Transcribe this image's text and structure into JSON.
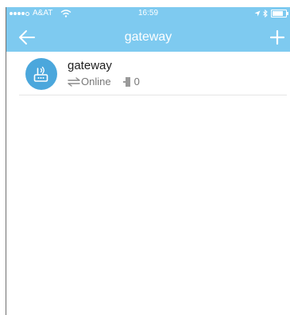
{
  "status_bar": {
    "carrier": "A&AT",
    "time": "16:59"
  },
  "header": {
    "title": "gateway",
    "back_icon": "arrow-left-icon",
    "add_icon": "plus-icon",
    "background_color": "#7ecaf0"
  },
  "devices": [
    {
      "name": "gateway",
      "status": "Online",
      "count": "0",
      "icon": "router-icon",
      "avatar_color": "#4ba7dc"
    }
  ]
}
